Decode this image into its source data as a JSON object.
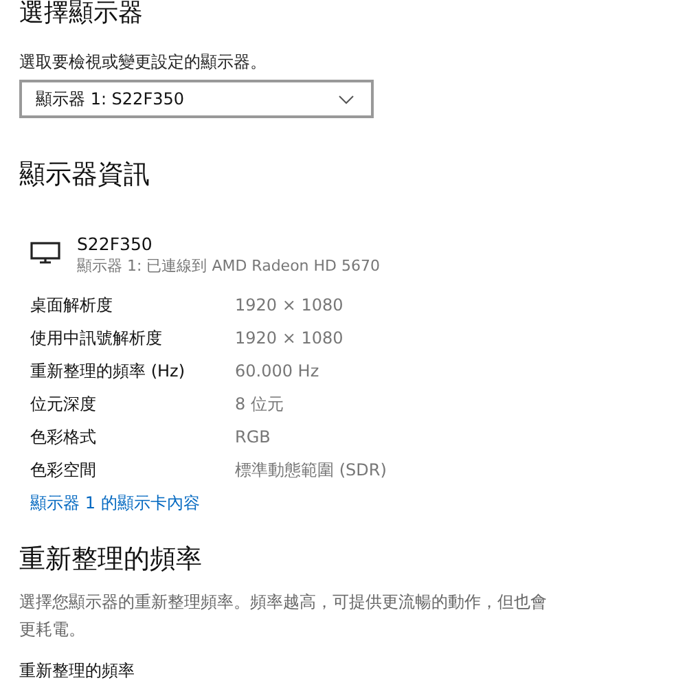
{
  "select_display": {
    "heading": "選擇顯示器",
    "description": "選取要檢視或變更設定的顯示器。",
    "dropdown": {
      "value": "顯示器 1: S22F350"
    }
  },
  "display_info": {
    "heading": "顯示器資訊",
    "monitor": {
      "name": "S22F350",
      "connection": "顯示器 1: 已連線到 AMD Radeon HD 5670"
    },
    "rows": [
      {
        "label": "桌面解析度",
        "value": "1920 × 1080"
      },
      {
        "label": "使用中訊號解析度",
        "value": "1920 × 1080"
      },
      {
        "label": "重新整理的頻率 (Hz)",
        "value": "60.000 Hz"
      },
      {
        "label": "位元深度",
        "value": "8 位元"
      },
      {
        "label": "色彩格式",
        "value": "RGB"
      },
      {
        "label": "色彩空間",
        "value": "標準動態範圍 (SDR)"
      }
    ],
    "link": "顯示器 1 的顯示卡內容"
  },
  "refresh_rate": {
    "heading": "重新整理的頻率",
    "description": "選擇您顯示器的重新整理頻率。頻率越高，可提供更流暢的動作，但也會更耗電。",
    "field_label": "重新整理的頻率"
  }
}
